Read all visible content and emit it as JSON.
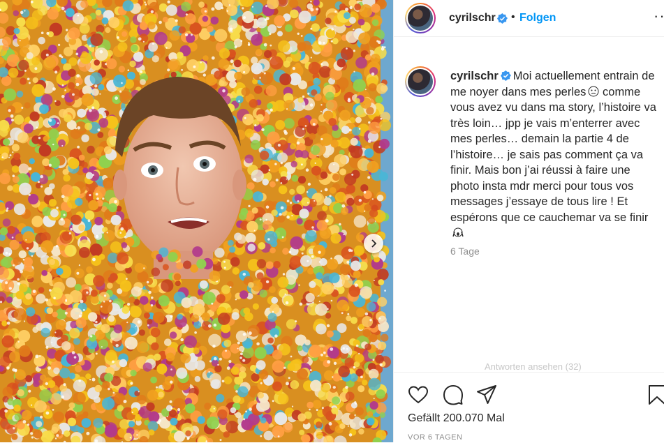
{
  "post": {
    "username": "cyrilschr",
    "follow_label": "Folgen",
    "dot": "•",
    "more_label": "···"
  },
  "caption": {
    "username": "cyrilschr",
    "text_part1": "Moi actuellement entrain de me noyer dans mes perles",
    "text_part2": " comme vous avez vu dans ma story, l’histoire va très loin… jpp je vais m’enterrer avec mes perles… demain la partie 4 de l’histoire… je sais pas comment ça va finir. Mais bon j’ai réussi à faire une photo insta mdr merci pour tous vos messages j’essaye de tous lire ! Et espérons que ce cauchemar va se finir",
    "time": "6 Tage"
  },
  "replies_label": "Antworten ansehen (32)",
  "stats": {
    "likes": "Gefällt 200.070 Mal",
    "posted": "VOR 6 TAGEN"
  },
  "icons": [
    "verified-icon",
    "heart-icon",
    "comment-icon",
    "share-icon",
    "bookmark-icon",
    "chevron-right-icon",
    "more-icon"
  ],
  "colors": {
    "link": "#0095f6",
    "verified": "#3897f0",
    "muted": "#8e8e8e",
    "text": "#262626"
  }
}
